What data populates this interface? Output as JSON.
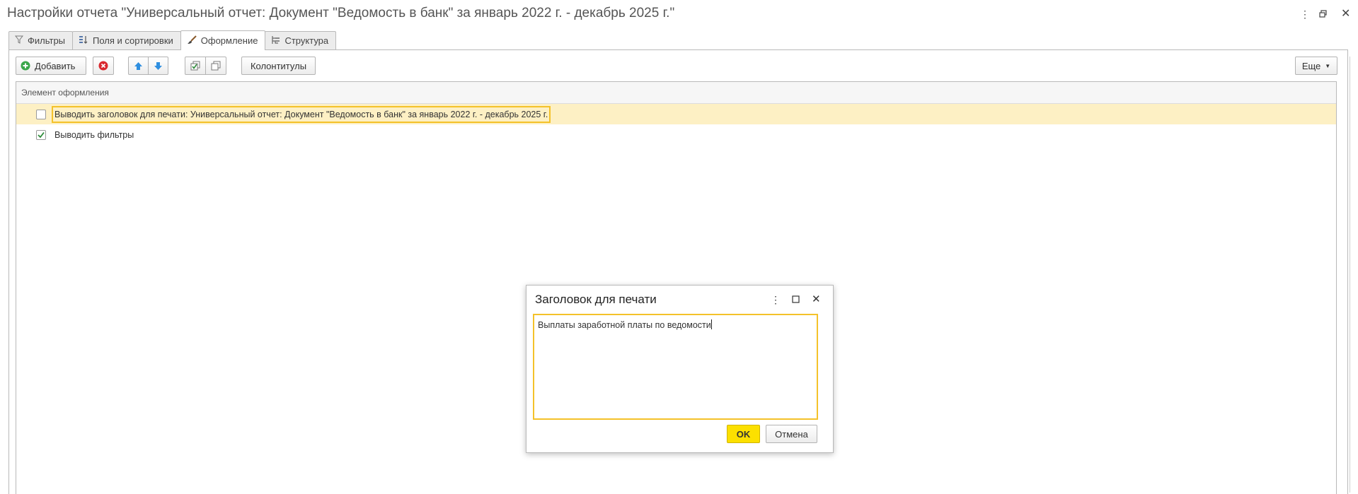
{
  "window": {
    "title": "Настройки отчета \"Универсальный отчет: Документ \"Ведомость в банк\" за январь 2022 г. - декабрь 2025 г.\""
  },
  "tabs": [
    {
      "label": "Фильтры",
      "icon": "funnel-icon"
    },
    {
      "label": "Поля и сортировки",
      "icon": "fields-sort-icon"
    },
    {
      "label": "Оформление",
      "icon": "brush-icon",
      "active": true
    },
    {
      "label": "Структура",
      "icon": "structure-icon"
    }
  ],
  "toolbar": {
    "add_label": "Добавить",
    "headers_footers_label": "Колонтитулы",
    "more_label": "Еще"
  },
  "grid": {
    "column_header": "Элемент оформления",
    "rows": [
      {
        "label": "Выводить заголовок для печати: Универсальный отчет: Документ \"Ведомость в банк\" за январь 2022 г. - декабрь 2025 г.",
        "checked": false,
        "selected": true
      },
      {
        "label": "Выводить фильтры",
        "checked": true,
        "selected": false
      }
    ]
  },
  "dialog": {
    "title": "Заголовок для печати",
    "text_value": "Выплаты заработной платы по ведомости",
    "ok_label": "OK",
    "cancel_label": "Отмена"
  },
  "colors": {
    "accent_yellow": "#fce000",
    "selection_bg": "#fdf0c4",
    "focus_border": "#f4c22a",
    "check_green": "#2e8b3a",
    "delete_red": "#d9282f",
    "add_green": "#3aa64a",
    "arrow_blue": "#2f8fe0"
  }
}
